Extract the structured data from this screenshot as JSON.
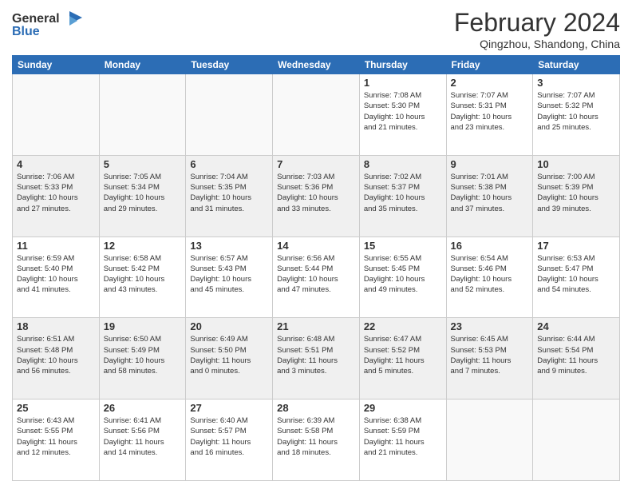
{
  "logo": {
    "line1": "General",
    "line2": "Blue"
  },
  "title": {
    "month_year": "February 2024",
    "location": "Qingzhou, Shandong, China"
  },
  "days_of_week": [
    "Sunday",
    "Monday",
    "Tuesday",
    "Wednesday",
    "Thursday",
    "Friday",
    "Saturday"
  ],
  "weeks": [
    [
      {
        "day": "",
        "info": ""
      },
      {
        "day": "",
        "info": ""
      },
      {
        "day": "",
        "info": ""
      },
      {
        "day": "",
        "info": ""
      },
      {
        "day": "1",
        "info": "Sunrise: 7:08 AM\nSunset: 5:30 PM\nDaylight: 10 hours\nand 21 minutes."
      },
      {
        "day": "2",
        "info": "Sunrise: 7:07 AM\nSunset: 5:31 PM\nDaylight: 10 hours\nand 23 minutes."
      },
      {
        "day": "3",
        "info": "Sunrise: 7:07 AM\nSunset: 5:32 PM\nDaylight: 10 hours\nand 25 minutes."
      }
    ],
    [
      {
        "day": "4",
        "info": "Sunrise: 7:06 AM\nSunset: 5:33 PM\nDaylight: 10 hours\nand 27 minutes."
      },
      {
        "day": "5",
        "info": "Sunrise: 7:05 AM\nSunset: 5:34 PM\nDaylight: 10 hours\nand 29 minutes."
      },
      {
        "day": "6",
        "info": "Sunrise: 7:04 AM\nSunset: 5:35 PM\nDaylight: 10 hours\nand 31 minutes."
      },
      {
        "day": "7",
        "info": "Sunrise: 7:03 AM\nSunset: 5:36 PM\nDaylight: 10 hours\nand 33 minutes."
      },
      {
        "day": "8",
        "info": "Sunrise: 7:02 AM\nSunset: 5:37 PM\nDaylight: 10 hours\nand 35 minutes."
      },
      {
        "day": "9",
        "info": "Sunrise: 7:01 AM\nSunset: 5:38 PM\nDaylight: 10 hours\nand 37 minutes."
      },
      {
        "day": "10",
        "info": "Sunrise: 7:00 AM\nSunset: 5:39 PM\nDaylight: 10 hours\nand 39 minutes."
      }
    ],
    [
      {
        "day": "11",
        "info": "Sunrise: 6:59 AM\nSunset: 5:40 PM\nDaylight: 10 hours\nand 41 minutes."
      },
      {
        "day": "12",
        "info": "Sunrise: 6:58 AM\nSunset: 5:42 PM\nDaylight: 10 hours\nand 43 minutes."
      },
      {
        "day": "13",
        "info": "Sunrise: 6:57 AM\nSunset: 5:43 PM\nDaylight: 10 hours\nand 45 minutes."
      },
      {
        "day": "14",
        "info": "Sunrise: 6:56 AM\nSunset: 5:44 PM\nDaylight: 10 hours\nand 47 minutes."
      },
      {
        "day": "15",
        "info": "Sunrise: 6:55 AM\nSunset: 5:45 PM\nDaylight: 10 hours\nand 49 minutes."
      },
      {
        "day": "16",
        "info": "Sunrise: 6:54 AM\nSunset: 5:46 PM\nDaylight: 10 hours\nand 52 minutes."
      },
      {
        "day": "17",
        "info": "Sunrise: 6:53 AM\nSunset: 5:47 PM\nDaylight: 10 hours\nand 54 minutes."
      }
    ],
    [
      {
        "day": "18",
        "info": "Sunrise: 6:51 AM\nSunset: 5:48 PM\nDaylight: 10 hours\nand 56 minutes."
      },
      {
        "day": "19",
        "info": "Sunrise: 6:50 AM\nSunset: 5:49 PM\nDaylight: 10 hours\nand 58 minutes."
      },
      {
        "day": "20",
        "info": "Sunrise: 6:49 AM\nSunset: 5:50 PM\nDaylight: 11 hours\nand 0 minutes."
      },
      {
        "day": "21",
        "info": "Sunrise: 6:48 AM\nSunset: 5:51 PM\nDaylight: 11 hours\nand 3 minutes."
      },
      {
        "day": "22",
        "info": "Sunrise: 6:47 AM\nSunset: 5:52 PM\nDaylight: 11 hours\nand 5 minutes."
      },
      {
        "day": "23",
        "info": "Sunrise: 6:45 AM\nSunset: 5:53 PM\nDaylight: 11 hours\nand 7 minutes."
      },
      {
        "day": "24",
        "info": "Sunrise: 6:44 AM\nSunset: 5:54 PM\nDaylight: 11 hours\nand 9 minutes."
      }
    ],
    [
      {
        "day": "25",
        "info": "Sunrise: 6:43 AM\nSunset: 5:55 PM\nDaylight: 11 hours\nand 12 minutes."
      },
      {
        "day": "26",
        "info": "Sunrise: 6:41 AM\nSunset: 5:56 PM\nDaylight: 11 hours\nand 14 minutes."
      },
      {
        "day": "27",
        "info": "Sunrise: 6:40 AM\nSunset: 5:57 PM\nDaylight: 11 hours\nand 16 minutes."
      },
      {
        "day": "28",
        "info": "Sunrise: 6:39 AM\nSunset: 5:58 PM\nDaylight: 11 hours\nand 18 minutes."
      },
      {
        "day": "29",
        "info": "Sunrise: 6:38 AM\nSunset: 5:59 PM\nDaylight: 11 hours\nand 21 minutes."
      },
      {
        "day": "",
        "info": ""
      },
      {
        "day": "",
        "info": ""
      }
    ]
  ]
}
